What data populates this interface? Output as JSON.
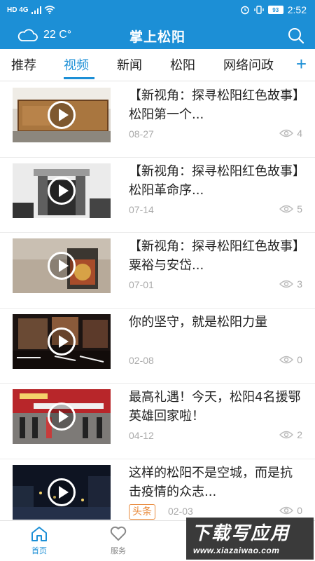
{
  "status_bar": {
    "network": "HD 4G",
    "battery": "93",
    "time": "2:52"
  },
  "header": {
    "temperature": "22 C°",
    "title": "掌上松阳",
    "weather_icon": "cloud-icon",
    "search_icon": "search-icon"
  },
  "tabs": [
    {
      "label": "推荐",
      "active": false
    },
    {
      "label": "视频",
      "active": true
    },
    {
      "label": "新闻",
      "active": false
    },
    {
      "label": "松阳",
      "active": false
    },
    {
      "label": "网络问政",
      "active": false
    }
  ],
  "tab_add": "+",
  "videos": [
    {
      "title": "【新视角：探寻松阳红色故事】松阳第一个...",
      "date": "08-27",
      "views": "4",
      "tag": ""
    },
    {
      "title": "【新视角：探寻松阳红色故事】松阳革命序...",
      "date": "07-14",
      "views": "5",
      "tag": ""
    },
    {
      "title": "【新视角：探寻松阳红色故事】粟裕与安岱...",
      "date": "07-01",
      "views": "3",
      "tag": ""
    },
    {
      "title": "你的坚守，就是松阳力量",
      "date": "02-08",
      "views": "0",
      "tag": ""
    },
    {
      "title": "最高礼遇！今天，松阳4名援鄂英雄回家啦！",
      "date": "04-12",
      "views": "2",
      "tag": ""
    },
    {
      "title": "这样的松阳不是空城，而是抗击疫情的众志...",
      "date": "02-03",
      "views": "0",
      "tag": "头条"
    }
  ],
  "bottom_nav": [
    {
      "label": "首页",
      "icon": "home-icon",
      "active": true
    },
    {
      "label": "服务",
      "icon": "heart-icon",
      "active": false
    }
  ],
  "watermark": {
    "text": "下载写应用",
    "url": "www.xiazaiwao.com"
  },
  "colors": {
    "brand": "#1c8fd6",
    "tag": "#e8893a",
    "muted": "#aaaaaa"
  }
}
